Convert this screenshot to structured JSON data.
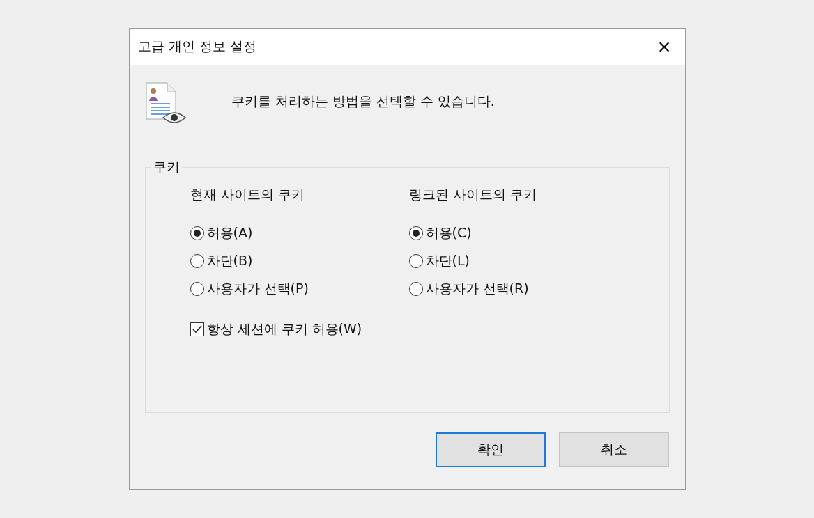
{
  "window": {
    "title": "고급 개인 정보 설정",
    "close": "×"
  },
  "intro": "쿠키를 처리하는 방법을 선택할 수 있습니다.",
  "group": {
    "title": "쿠키",
    "columns": [
      {
        "heading": "현재 사이트의 쿠키",
        "options": [
          {
            "label": "허용(A)",
            "selected": true
          },
          {
            "label": "차단(B)",
            "selected": false
          },
          {
            "label": "사용자가 선택(P)",
            "selected": false
          }
        ]
      },
      {
        "heading": "링크된 사이트의 쿠키",
        "options": [
          {
            "label": "허용(C)",
            "selected": true
          },
          {
            "label": "차단(L)",
            "selected": false
          },
          {
            "label": "사용자가 선택(R)",
            "selected": false
          }
        ]
      }
    ],
    "checkbox": {
      "label": "항상 세션에 쿠키 허용(W)",
      "checked": true
    }
  },
  "buttons": [
    {
      "label": "확인",
      "default": true
    },
    {
      "label": "취소",
      "default": false
    }
  ]
}
